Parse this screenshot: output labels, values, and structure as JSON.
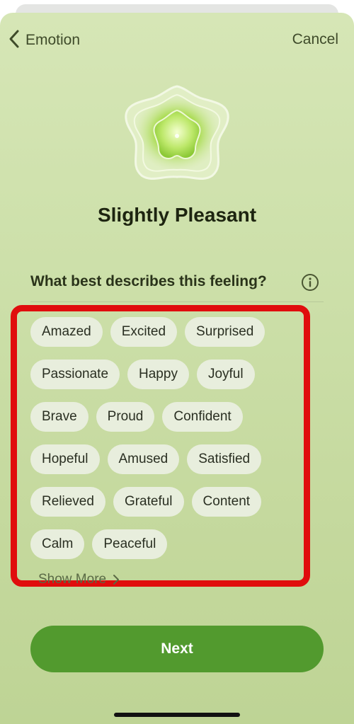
{
  "nav": {
    "back_label": "Emotion",
    "cancel_label": "Cancel"
  },
  "mood": {
    "title": "Slightly Pleasant"
  },
  "question": {
    "text": "What best describes this feeling?"
  },
  "chips": [
    "Amazed",
    "Excited",
    "Surprised",
    "Passionate",
    "Happy",
    "Joyful",
    "Brave",
    "Proud",
    "Confident",
    "Hopeful",
    "Amused",
    "Satisfied",
    "Relieved",
    "Grateful",
    "Content",
    "Calm",
    "Peaceful"
  ],
  "show_more_label": "Show More",
  "next_label": "Next",
  "colors": {
    "background": "#cde0aa",
    "accent": "#529a2e",
    "chip": "#e8eedd",
    "highlight": "#e00d0d"
  },
  "icons": {
    "back": "chevron-left-icon",
    "info": "info-circle-icon",
    "show_more": "chevron-right-icon",
    "orb": "flower-orb-icon"
  }
}
